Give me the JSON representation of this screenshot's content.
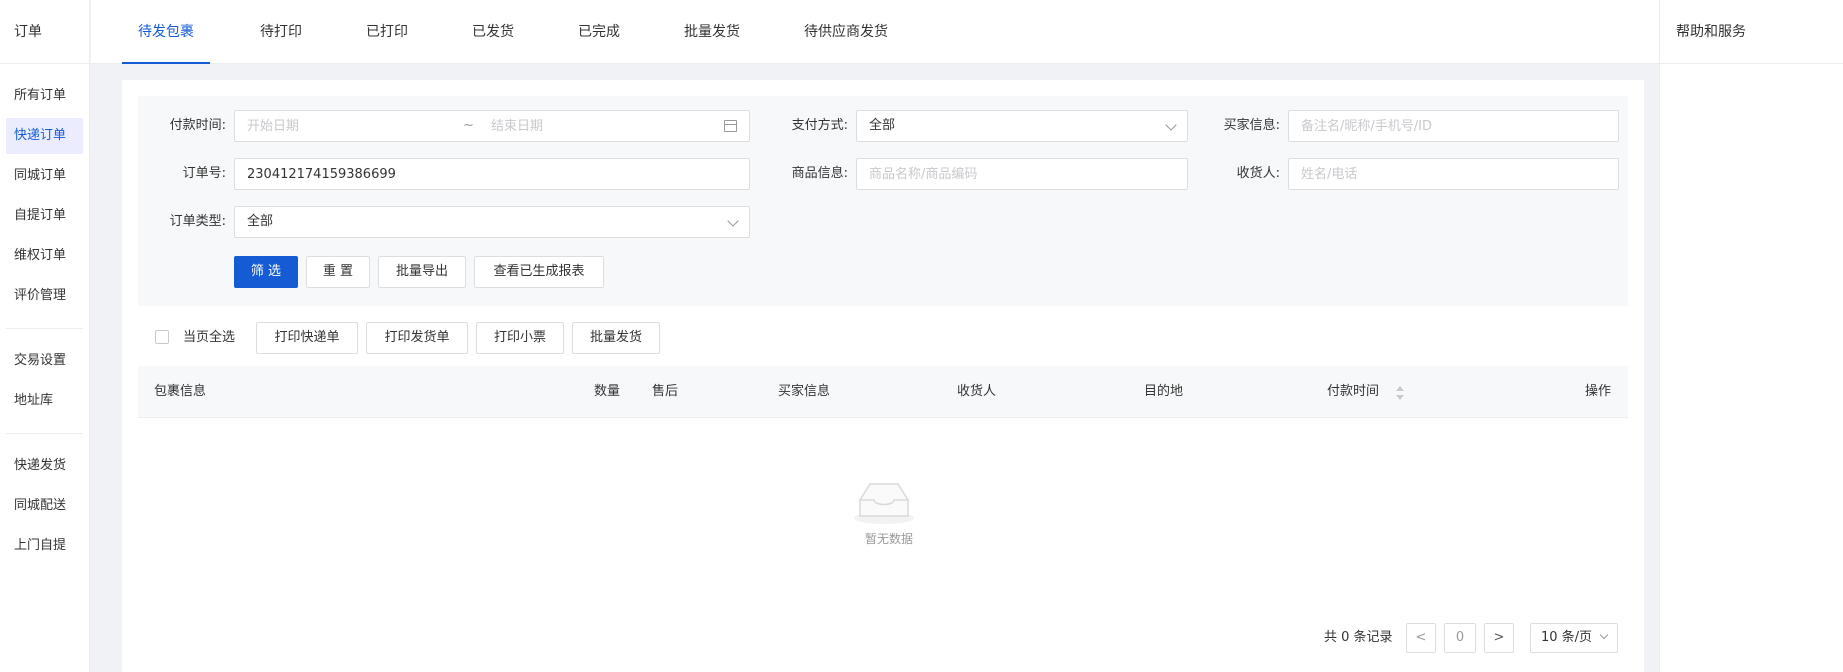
{
  "sidebar": {
    "title": "订单",
    "groups": [
      [
        "所有订单",
        "快递订单",
        "同城订单",
        "自提订单",
        "维权订单",
        "评价管理"
      ],
      [
        "交易设置",
        "地址库"
      ],
      [
        "快递发货",
        "同城配送",
        "上门自提"
      ]
    ],
    "active_item": "快递订单"
  },
  "tabs": [
    "待发包裹",
    "待打印",
    "已打印",
    "已发货",
    "已完成",
    "批量发货",
    "待供应商发货"
  ],
  "help": {
    "title": "帮助和服务"
  },
  "filter": {
    "pay_time_label": "付款时间:",
    "start_date_placeholder": "开始日期",
    "date_separator": "~",
    "end_date_placeholder": "结束日期",
    "pay_method_label": "支付方式:",
    "pay_method_value": "全部",
    "buyer_label": "买家信息:",
    "buyer_placeholder": "备注名/昵称/手机号/ID",
    "order_no_label": "订单号:",
    "order_no_value": "230412174159386699",
    "product_label": "商品信息:",
    "product_placeholder": "商品名称/商品编码",
    "receiver_label": "收货人:",
    "receiver_placeholder": "姓名/电话",
    "order_type_label": "订单类型:",
    "order_type_value": "全部",
    "btn_filter": "筛 选",
    "btn_reset": "重 置",
    "btn_export": "批量导出",
    "btn_reports": "查看已生成报表"
  },
  "actions": {
    "select_all_label": "当页全选",
    "print_express": "打印快递单",
    "print_delivery": "打印发货单",
    "print_receipt": "打印小票",
    "batch_ship": "批量发货"
  },
  "table": {
    "headers": [
      "包裹信息",
      "数量",
      "售后",
      "买家信息",
      "收货人",
      "目的地",
      "付款时间",
      "操作"
    ],
    "empty_text": "暂无数据"
  },
  "pagination": {
    "total_text": "共 0 条记录",
    "prev": "<",
    "current_page": "0",
    "next": ">",
    "page_size": "10 条/页"
  },
  "colors": {
    "primary": "#155bd4",
    "active_nav_bg": "#ebedff"
  }
}
